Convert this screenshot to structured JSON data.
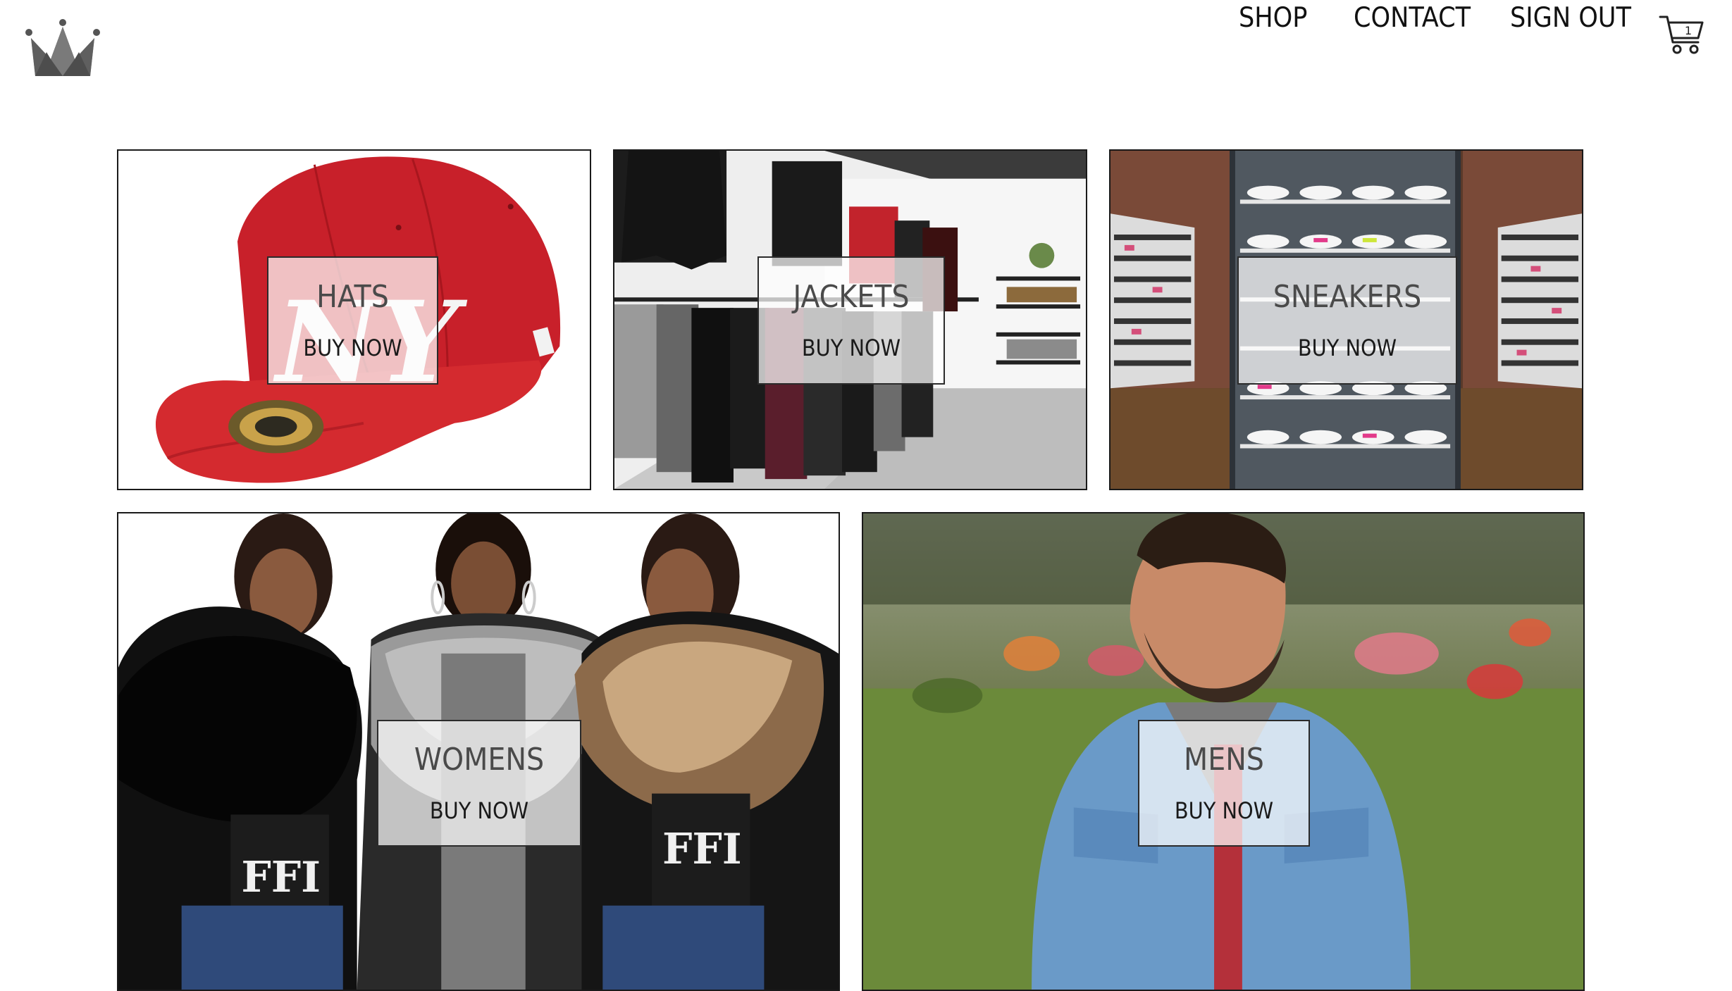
{
  "header": {
    "logo_icon": "crown-icon",
    "nav": {
      "shop": "SHOP",
      "contact": "CONTACT",
      "sign_out": "SIGN OUT"
    },
    "cart": {
      "icon": "shopping-cart-icon",
      "count": "1"
    }
  },
  "categories": [
    {
      "title": "HATS",
      "cta": "BUY NOW",
      "image": "red-fitted-cap-photo"
    },
    {
      "title": "JACKETS",
      "cta": "BUY NOW",
      "image": "clothing-store-racks-photo"
    },
    {
      "title": "SNEAKERS",
      "cta": "BUY NOW",
      "image": "sneaker-store-wall-photo"
    },
    {
      "title": "WOMENS",
      "cta": "BUY NOW",
      "image": "three-women-fur-jackets-photo"
    },
    {
      "title": "MENS",
      "cta": "BUY NOW",
      "image": "man-denim-jacket-photo"
    }
  ],
  "colors": {
    "border": "#1a1a1a",
    "text": "#111111",
    "label_bg": "rgba(255,255,255,0.72)",
    "logo": "#6b6b6b"
  }
}
